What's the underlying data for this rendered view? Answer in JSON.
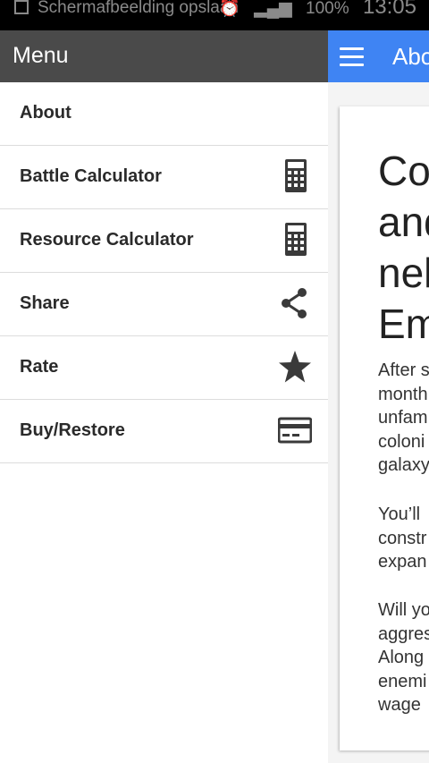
{
  "status_bar": {
    "notification": "Schermafbeelding opslaan",
    "battery": "100%",
    "time": "13:05"
  },
  "app_bar": {
    "title": "About"
  },
  "content": {
    "heading": "Co\nand\nnel\nEm",
    "paragraph1": "After s\nmonth\nunfam\ncoloni\ngalaxy",
    "paragraph2": "You’ll\nconstr\nexpan",
    "paragraph3": "Will yo\naggres\nAlong\nenemi\nwage"
  },
  "drawer": {
    "title": "Menu",
    "items": [
      {
        "label": "About",
        "icon": ""
      },
      {
        "label": "Battle Calculator",
        "icon": "calculator-icon"
      },
      {
        "label": "Resource Calculator",
        "icon": "calculator-icon"
      },
      {
        "label": "Share",
        "icon": "share-icon"
      },
      {
        "label": "Rate",
        "icon": "star-icon"
      },
      {
        "label": "Buy/Restore",
        "icon": "credit-card-icon"
      }
    ]
  }
}
